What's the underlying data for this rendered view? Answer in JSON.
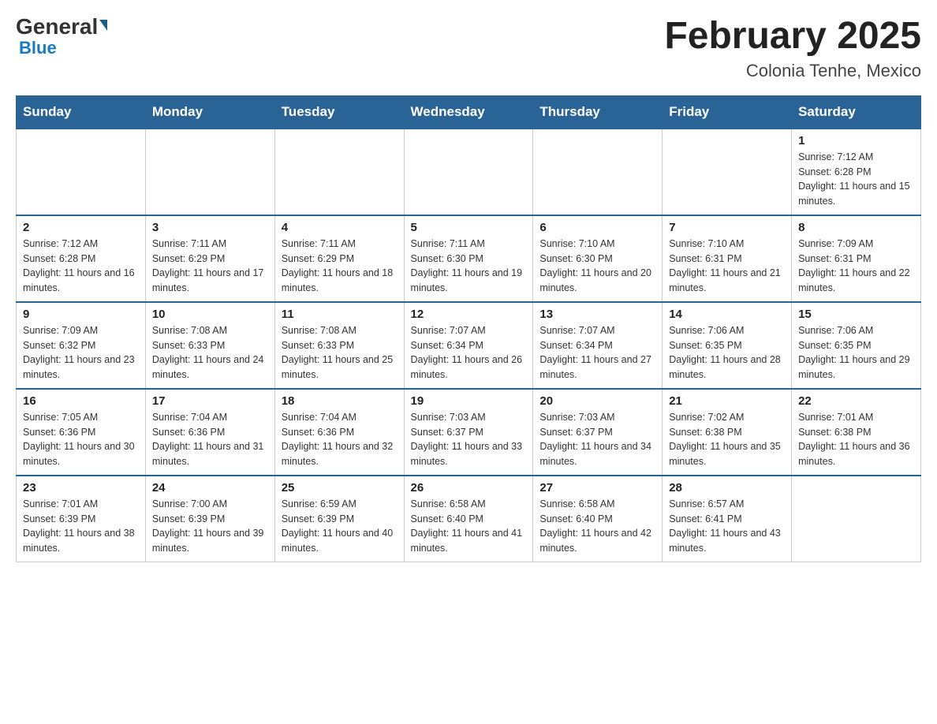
{
  "header": {
    "logo_general": "General",
    "logo_blue": "Blue",
    "month_title": "February 2025",
    "location": "Colonia Tenhe, Mexico"
  },
  "weekdays": [
    "Sunday",
    "Monday",
    "Tuesday",
    "Wednesday",
    "Thursday",
    "Friday",
    "Saturday"
  ],
  "weeks": [
    [
      {
        "day": "",
        "info": ""
      },
      {
        "day": "",
        "info": ""
      },
      {
        "day": "",
        "info": ""
      },
      {
        "day": "",
        "info": ""
      },
      {
        "day": "",
        "info": ""
      },
      {
        "day": "",
        "info": ""
      },
      {
        "day": "1",
        "info": "Sunrise: 7:12 AM\nSunset: 6:28 PM\nDaylight: 11 hours and 15 minutes."
      }
    ],
    [
      {
        "day": "2",
        "info": "Sunrise: 7:12 AM\nSunset: 6:28 PM\nDaylight: 11 hours and 16 minutes."
      },
      {
        "day": "3",
        "info": "Sunrise: 7:11 AM\nSunset: 6:29 PM\nDaylight: 11 hours and 17 minutes."
      },
      {
        "day": "4",
        "info": "Sunrise: 7:11 AM\nSunset: 6:29 PM\nDaylight: 11 hours and 18 minutes."
      },
      {
        "day": "5",
        "info": "Sunrise: 7:11 AM\nSunset: 6:30 PM\nDaylight: 11 hours and 19 minutes."
      },
      {
        "day": "6",
        "info": "Sunrise: 7:10 AM\nSunset: 6:30 PM\nDaylight: 11 hours and 20 minutes."
      },
      {
        "day": "7",
        "info": "Sunrise: 7:10 AM\nSunset: 6:31 PM\nDaylight: 11 hours and 21 minutes."
      },
      {
        "day": "8",
        "info": "Sunrise: 7:09 AM\nSunset: 6:31 PM\nDaylight: 11 hours and 22 minutes."
      }
    ],
    [
      {
        "day": "9",
        "info": "Sunrise: 7:09 AM\nSunset: 6:32 PM\nDaylight: 11 hours and 23 minutes."
      },
      {
        "day": "10",
        "info": "Sunrise: 7:08 AM\nSunset: 6:33 PM\nDaylight: 11 hours and 24 minutes."
      },
      {
        "day": "11",
        "info": "Sunrise: 7:08 AM\nSunset: 6:33 PM\nDaylight: 11 hours and 25 minutes."
      },
      {
        "day": "12",
        "info": "Sunrise: 7:07 AM\nSunset: 6:34 PM\nDaylight: 11 hours and 26 minutes."
      },
      {
        "day": "13",
        "info": "Sunrise: 7:07 AM\nSunset: 6:34 PM\nDaylight: 11 hours and 27 minutes."
      },
      {
        "day": "14",
        "info": "Sunrise: 7:06 AM\nSunset: 6:35 PM\nDaylight: 11 hours and 28 minutes."
      },
      {
        "day": "15",
        "info": "Sunrise: 7:06 AM\nSunset: 6:35 PM\nDaylight: 11 hours and 29 minutes."
      }
    ],
    [
      {
        "day": "16",
        "info": "Sunrise: 7:05 AM\nSunset: 6:36 PM\nDaylight: 11 hours and 30 minutes."
      },
      {
        "day": "17",
        "info": "Sunrise: 7:04 AM\nSunset: 6:36 PM\nDaylight: 11 hours and 31 minutes."
      },
      {
        "day": "18",
        "info": "Sunrise: 7:04 AM\nSunset: 6:36 PM\nDaylight: 11 hours and 32 minutes."
      },
      {
        "day": "19",
        "info": "Sunrise: 7:03 AM\nSunset: 6:37 PM\nDaylight: 11 hours and 33 minutes."
      },
      {
        "day": "20",
        "info": "Sunrise: 7:03 AM\nSunset: 6:37 PM\nDaylight: 11 hours and 34 minutes."
      },
      {
        "day": "21",
        "info": "Sunrise: 7:02 AM\nSunset: 6:38 PM\nDaylight: 11 hours and 35 minutes."
      },
      {
        "day": "22",
        "info": "Sunrise: 7:01 AM\nSunset: 6:38 PM\nDaylight: 11 hours and 36 minutes."
      }
    ],
    [
      {
        "day": "23",
        "info": "Sunrise: 7:01 AM\nSunset: 6:39 PM\nDaylight: 11 hours and 38 minutes."
      },
      {
        "day": "24",
        "info": "Sunrise: 7:00 AM\nSunset: 6:39 PM\nDaylight: 11 hours and 39 minutes."
      },
      {
        "day": "25",
        "info": "Sunrise: 6:59 AM\nSunset: 6:39 PM\nDaylight: 11 hours and 40 minutes."
      },
      {
        "day": "26",
        "info": "Sunrise: 6:58 AM\nSunset: 6:40 PM\nDaylight: 11 hours and 41 minutes."
      },
      {
        "day": "27",
        "info": "Sunrise: 6:58 AM\nSunset: 6:40 PM\nDaylight: 11 hours and 42 minutes."
      },
      {
        "day": "28",
        "info": "Sunrise: 6:57 AM\nSunset: 6:41 PM\nDaylight: 11 hours and 43 minutes."
      },
      {
        "day": "",
        "info": ""
      }
    ]
  ]
}
